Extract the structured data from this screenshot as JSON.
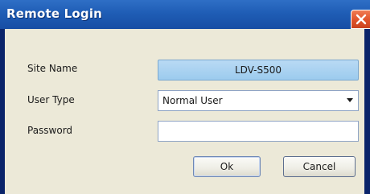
{
  "dialog": {
    "title": "Remote Login",
    "close_icon": "close-x-icon"
  },
  "form": {
    "site_name_label": "Site Name",
    "site_name_value": "LDV-S500",
    "user_type_label": "User Type",
    "user_type_value": "Normal User",
    "password_label": "Password",
    "password_value": ""
  },
  "buttons": {
    "ok_label": "Ok",
    "cancel_label": "Cancel"
  },
  "colors": {
    "titlebar": "#1f5db5",
    "close": "#e0522a",
    "dialog_bg": "#ece9d8",
    "site_field": "#9ccbee"
  }
}
